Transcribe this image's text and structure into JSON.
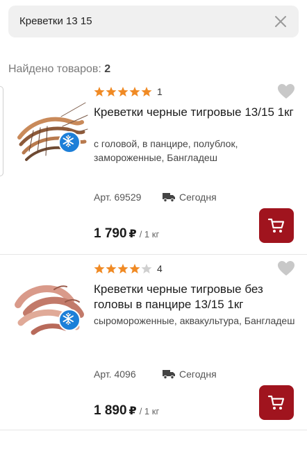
{
  "search": {
    "query": "Креветки 13 15"
  },
  "results": {
    "found_label": "Найдено товаров:",
    "found_count": "2"
  },
  "products": [
    {
      "rating": 5,
      "rating_count": "1",
      "title": "Креветки черные тигровые 13/15 1кг",
      "description": "с головой, в панцире, полублок, замороженные, Бангладеш",
      "sku": "Арт. 69529",
      "delivery": "Сегодня",
      "price": "1 790",
      "currency": "₽",
      "unit": "/ 1 кг",
      "badge_icon": "snowflake-icon"
    },
    {
      "rating": 4,
      "rating_count": "4",
      "title": "Креветки черные тигровые без головы в панцире 13/15 1кг",
      "description": "сыромороженные, аквакультура, Бангладеш",
      "sku": "Арт. 4096",
      "delivery": "Сегодня",
      "price": "1 890",
      "currency": "₽",
      "unit": "/ 1 кг",
      "badge_icon": "snowflake-icon"
    }
  ],
  "colors": {
    "star": "#f08a24",
    "star_empty": "#cfcfcf",
    "cart": "#a0141e",
    "frost": "#1d7fd8",
    "heart": "#c8c8c8"
  }
}
